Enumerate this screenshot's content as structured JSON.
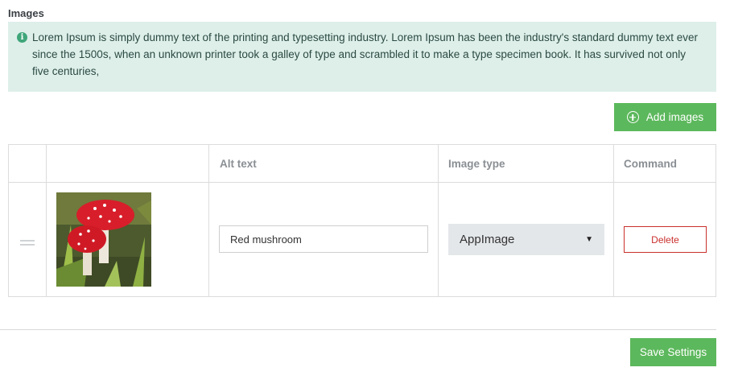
{
  "section": {
    "title": "Images"
  },
  "info": {
    "icon": "info-icon",
    "text": "Lorem Ipsum is simply dummy text of the printing and typesetting industry. Lorem Ipsum has been the industry's standard dummy text ever since the 1500s, when an unknown printer took a galley of type and scrambled it to make a type specimen book. It has survived not only five centuries,"
  },
  "toolbar": {
    "add_label": "Add images",
    "add_icon": "plus-circle-icon"
  },
  "table": {
    "headers": [
      "",
      "",
      "Alt text",
      "Image type",
      "Command"
    ],
    "rows": [
      {
        "image": "red-mushroom-thumbnail",
        "alt_text": "Red mushroom",
        "image_type": "AppImage",
        "command": "Delete"
      }
    ]
  },
  "footer": {
    "save_label": "Save Settings"
  },
  "colors": {
    "accent": "#5cb85c",
    "danger": "#c9302c",
    "info_bg": "#deefea"
  }
}
